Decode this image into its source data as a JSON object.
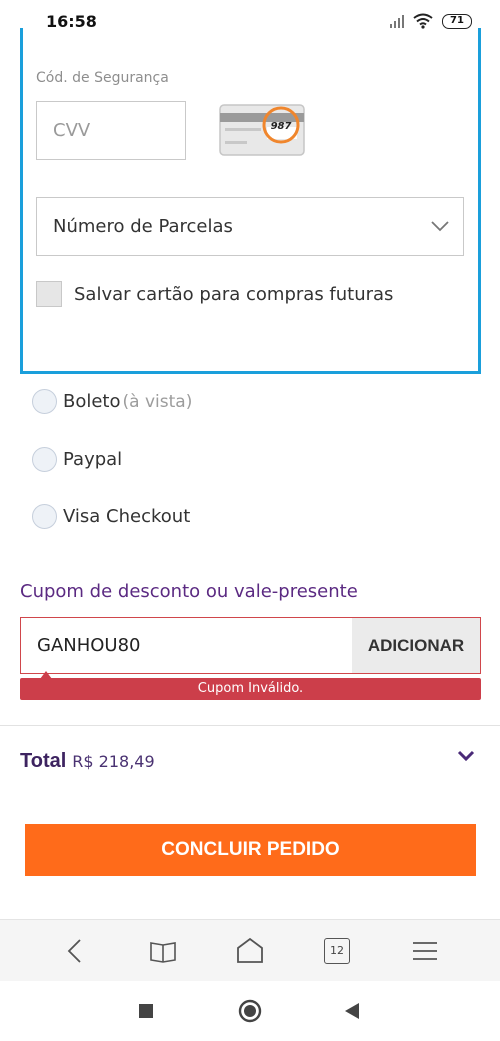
{
  "status_bar": {
    "time": "16:58",
    "battery": "71",
    "icons": [
      "signal-icon",
      "wifi-icon",
      "battery-icon"
    ]
  },
  "card_form": {
    "cvv_label": "Cód. de Segurança",
    "cvv_placeholder": "CVV",
    "card_sample_code": "987",
    "installments_placeholder": "Número de Parcelas",
    "save_card_label": "Salvar cartão para compras futuras",
    "accent_color": "#1a9fdb"
  },
  "payment_options": [
    {
      "name": "Boleto",
      "note": "(à vista)"
    },
    {
      "name": "Paypal",
      "note": ""
    },
    {
      "name": "Visa Checkout",
      "note": ""
    }
  ],
  "coupon": {
    "title": "Cupom de desconto ou vale-presente",
    "value": "GANHOU80",
    "button_label": "ADICIONAR",
    "error_message": "Cupom Inválido.",
    "error_color": "#cc3e4a"
  },
  "summary": {
    "total_label": "Total",
    "total_value": "R$ 218,49",
    "brand_color": "#5b2a82"
  },
  "checkout": {
    "button_label": "CONCLUIR PEDIDO",
    "button_color": "#ff6b1a"
  },
  "browser_nav": {
    "tab_count": "12",
    "icons": [
      "back-icon",
      "bookmarks-icon",
      "home-icon",
      "tabs-icon",
      "menu-icon"
    ]
  },
  "android_nav": {
    "icons": [
      "recents-icon",
      "home-circle-icon",
      "back-triangle-icon"
    ]
  }
}
